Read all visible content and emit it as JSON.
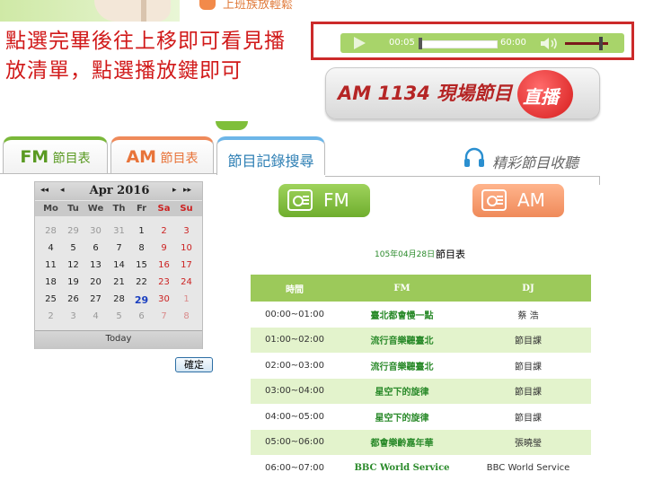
{
  "banner": {
    "brand_text": "上班族放輕鬆"
  },
  "note": "點選完畢後往上移即可看見播放清單，點選播放鍵即可",
  "player": {
    "current_time": "00:05",
    "duration": "60:00"
  },
  "live_button": {
    "label": "AM 1134 現場節目",
    "badge": "直播"
  },
  "tabs": {
    "fm": {
      "prefix": "FM",
      "suffix": " 節目表"
    },
    "am": {
      "prefix": "AM",
      "suffix": " 節目表"
    },
    "search": {
      "label": "節目記錄搜尋"
    }
  },
  "listen_link": "精彩節目收聽",
  "calendar": {
    "month_label": "Apr 2016",
    "nav": {
      "prev_year": "◂◂",
      "prev_month": "◂",
      "next_month": "▸",
      "next_year": "▸▸"
    },
    "weekdays": [
      "Mo",
      "Tu",
      "We",
      "Th",
      "Fr",
      "Sa",
      "Su"
    ],
    "weeks": [
      [
        {
          "d": "28",
          "o": true
        },
        {
          "d": "29",
          "o": true
        },
        {
          "d": "30",
          "o": true
        },
        {
          "d": "31",
          "o": true
        },
        {
          "d": "1"
        },
        {
          "d": "2"
        },
        {
          "d": "3"
        }
      ],
      [
        {
          "d": "4"
        },
        {
          "d": "5"
        },
        {
          "d": "6"
        },
        {
          "d": "7"
        },
        {
          "d": "8"
        },
        {
          "d": "9"
        },
        {
          "d": "10"
        }
      ],
      [
        {
          "d": "11"
        },
        {
          "d": "12"
        },
        {
          "d": "13"
        },
        {
          "d": "14"
        },
        {
          "d": "15"
        },
        {
          "d": "16"
        },
        {
          "d": "17"
        }
      ],
      [
        {
          "d": "18"
        },
        {
          "d": "19"
        },
        {
          "d": "20"
        },
        {
          "d": "21"
        },
        {
          "d": "22"
        },
        {
          "d": "23"
        },
        {
          "d": "24"
        }
      ],
      [
        {
          "d": "25"
        },
        {
          "d": "26"
        },
        {
          "d": "27"
        },
        {
          "d": "28"
        },
        {
          "d": "29",
          "sel": true
        },
        {
          "d": "30"
        },
        {
          "d": "1",
          "o": true
        }
      ],
      [
        {
          "d": "2",
          "o": true
        },
        {
          "d": "3",
          "o": true
        },
        {
          "d": "4",
          "o": true
        },
        {
          "d": "5",
          "o": true
        },
        {
          "d": "6",
          "o": true
        },
        {
          "d": "7",
          "o": true
        },
        {
          "d": "8",
          "o": true
        }
      ]
    ],
    "today_label": "Today",
    "colors": {
      "weekday": "#222222",
      "weekend": "#cc2222",
      "other_month": "#999999",
      "other_weekend": "#d98a8a",
      "selected": "#1a3fc0"
    }
  },
  "confirm_label": "確定",
  "channel_buttons": {
    "fm": "FM",
    "am": "AM"
  },
  "schedule": {
    "date": "105年04月28日",
    "title": "節目表",
    "headers": [
      "時間",
      "FM",
      "DJ"
    ],
    "rows": [
      {
        "time": "00:00~01:00",
        "program": "臺北都會慢一點",
        "dj": "蔡 浩"
      },
      {
        "time": "01:00~02:00",
        "program": "流行音樂聽臺北",
        "dj": "節目課"
      },
      {
        "time": "02:00~03:00",
        "program": "流行音樂聽臺北",
        "dj": "節目課"
      },
      {
        "time": "03:00~04:00",
        "program": "星空下的旋律",
        "dj": "節目課"
      },
      {
        "time": "04:00~05:00",
        "program": "星空下的旋律",
        "dj": "節目課"
      },
      {
        "time": "05:00~06:00",
        "program": "都會樂齡嘉年華",
        "dj": "張曉瑩"
      },
      {
        "time": "06:00~07:00",
        "program": "BBC World Service",
        "dj": "BBC World Service"
      }
    ]
  }
}
